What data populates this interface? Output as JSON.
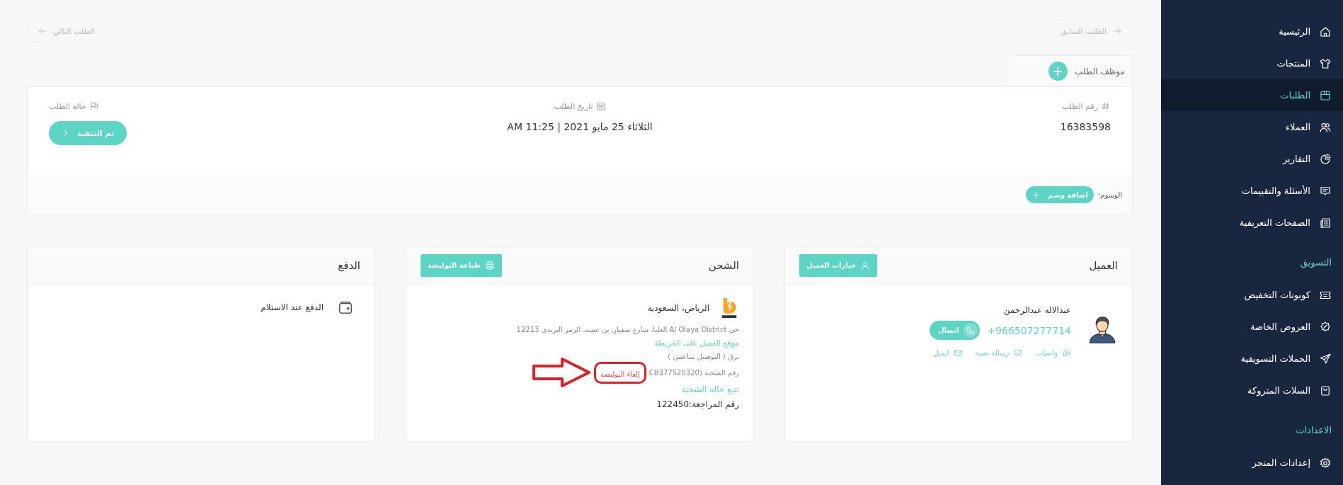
{
  "nav": {
    "previous": "الطلب السابق",
    "next": "الطلب التالي"
  },
  "order": {
    "staff_label": "موظف الطلب",
    "number_label": "رقم الطلب",
    "number": "16383598",
    "date_label": "تاريخ الطلب",
    "date": "الثلاثاء 25 مايو 2021 | 11:25 AM",
    "status_label": "حالة الطلب",
    "status": "تم التنفيذ",
    "tags_label": "الوسوم:",
    "add_tag": "اضافة وسم"
  },
  "customer": {
    "title": "العميل",
    "options_button": "خيارات العميل",
    "name": "عبدالاله عبدالرحمن",
    "phone": "+966507277714",
    "call_button": "اتصال",
    "contacts": [
      {
        "kind": "whatsapp",
        "label": "واتساب"
      },
      {
        "kind": "sms",
        "label": "رسالة نصية"
      },
      {
        "kind": "email",
        "label": "ايميل"
      }
    ]
  },
  "shipping": {
    "title": "الشحن",
    "print_button": "طباعة البوليصة",
    "city": "الرياض، السعودية",
    "address": "حى Al Olaya District العليا، شارع سفيان بن عيينة، الرمز البريدى 12213",
    "map_link": "موقع العميل على الخريطة",
    "method": "برق ( التوصيل ساعتين )",
    "tracking_label": "رقم الشحنة (CB377520320",
    "cancel_link": "إلغاء البوليصة",
    "track_link": "تتبع حالة الشحنة",
    "reference": "رقم المراجعة:122450"
  },
  "payment": {
    "title": "الدفع",
    "method": "الدفع عند الاستلام"
  },
  "sidebar": {
    "sections": [
      {
        "items": [
          {
            "label": "الرئيسية",
            "selected": false
          },
          {
            "label": "المنتجات",
            "selected": false
          },
          {
            "label": "الطلبات",
            "selected": true
          },
          {
            "label": "العملاء",
            "selected": false
          },
          {
            "label": "التقارير",
            "selected": false
          },
          {
            "label": "الأسئلة والتقييمات",
            "selected": false
          },
          {
            "label": "الصفحات التعريفية",
            "selected": false
          }
        ]
      },
      {
        "heading": "التسويق",
        "items": [
          {
            "label": "كوبونات التخفيض",
            "selected": false
          },
          {
            "label": "العروض الخاصة",
            "selected": false
          },
          {
            "label": "الحملات التسويقية",
            "selected": false
          },
          {
            "label": "السلات المتروكة",
            "selected": false
          }
        ]
      },
      {
        "heading": "الاعدادات",
        "items": [
          {
            "label": "إعدادات المتجر",
            "selected": false
          }
        ]
      }
    ]
  }
}
